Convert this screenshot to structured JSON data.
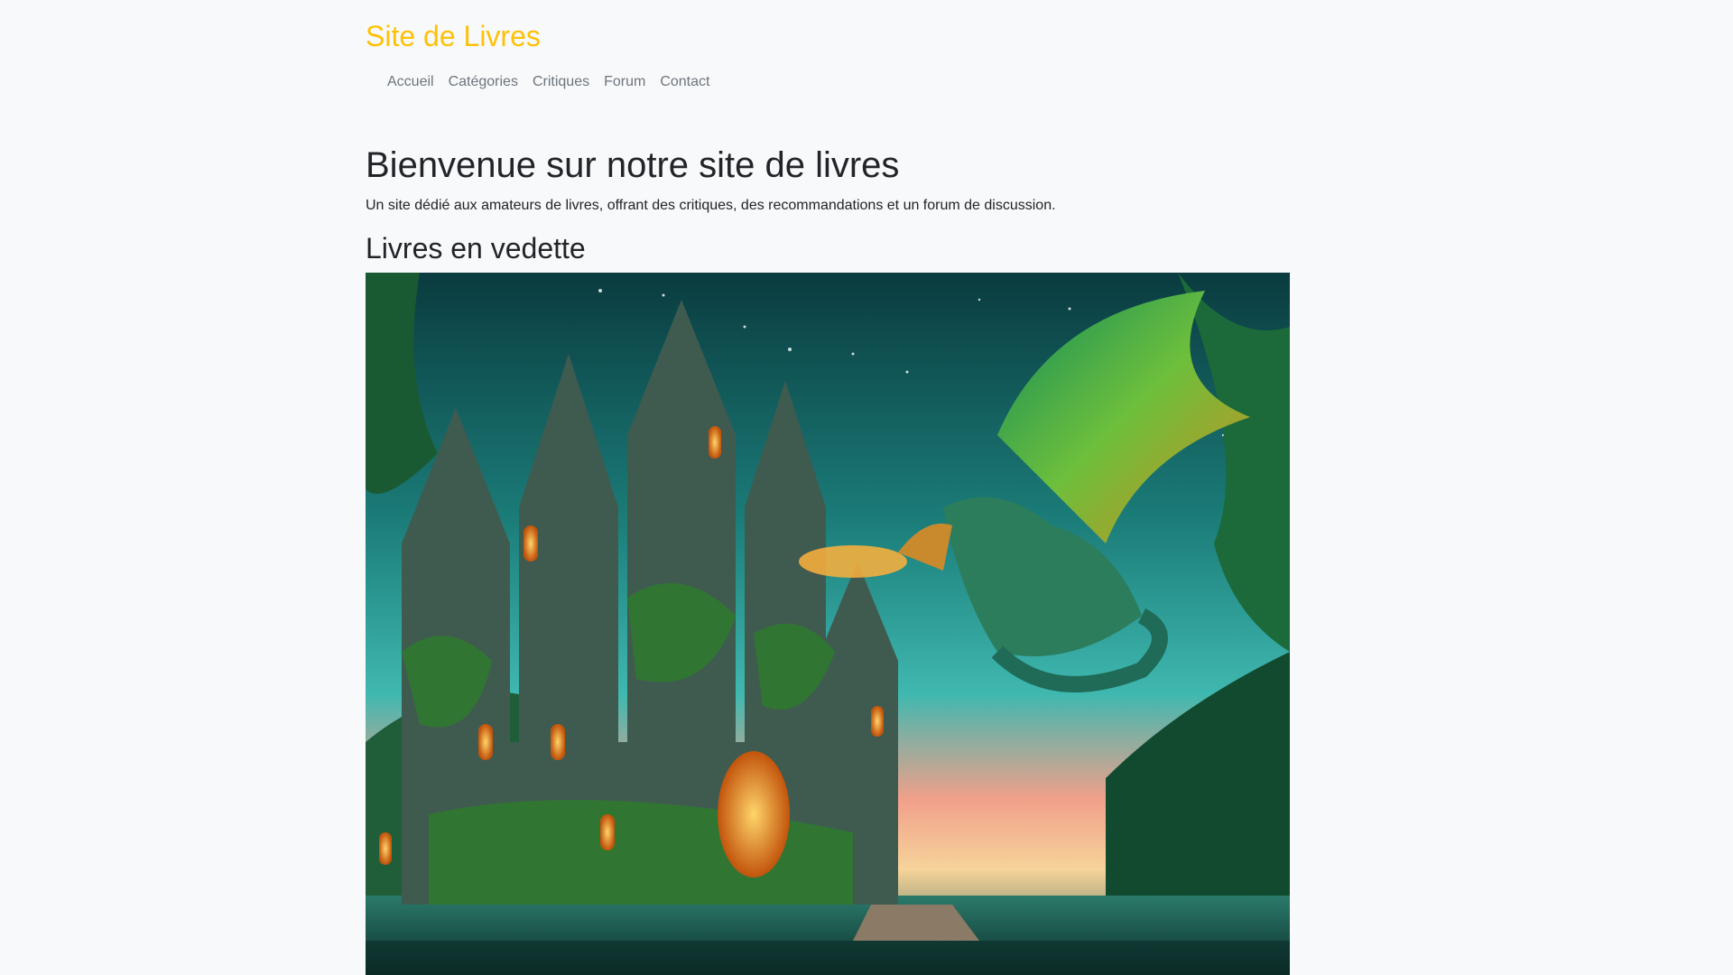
{
  "header": {
    "brand": "Site de Livres",
    "brand_color": "#ffc107",
    "nav": [
      {
        "label": "Accueil"
      },
      {
        "label": "Catégories"
      },
      {
        "label": "Critiques"
      },
      {
        "label": "Forum"
      },
      {
        "label": "Contact"
      }
    ]
  },
  "hero": {
    "title": "Bienvenue sur notre site de livres",
    "subtitle": "Un site dédié aux amateurs de livres, offrant des critiques, des recommandations et un forum de discussion."
  },
  "featured": {
    "heading": "Livres en vedette",
    "image_icon": "fantasy-castle-dragon-illustration"
  },
  "colors": {
    "background": "#f8f9fa",
    "text": "#212529",
    "nav_text": "#6c757d"
  }
}
